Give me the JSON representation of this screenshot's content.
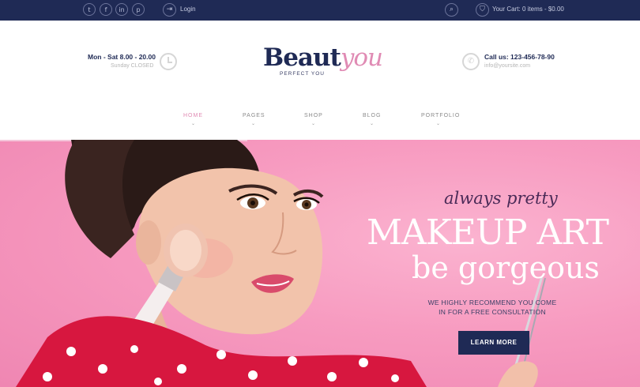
{
  "topbar": {
    "social": [
      {
        "icon": "twitter-icon",
        "glyph": "t"
      },
      {
        "icon": "facebook-icon",
        "glyph": "f"
      },
      {
        "icon": "linkedin-icon",
        "glyph": "in"
      },
      {
        "icon": "pinterest-icon",
        "glyph": "p"
      }
    ],
    "login_label": "Login",
    "cart_label": "Your Cart: 0 items - $0.00"
  },
  "header": {
    "hours_title": "Mon - Sat 8.00 - 20.00",
    "hours_sub": "Sunday CLOSED",
    "logo_part1": "Beaut",
    "logo_part2": "you",
    "tagline": "PERFECT YOU",
    "call_title": "Call us: 123-456-78-90",
    "call_sub": "info@yoursite.com"
  },
  "nav": {
    "items": [
      {
        "label": "HOME",
        "active": true
      },
      {
        "label": "PAGES",
        "active": false
      },
      {
        "label": "SHOP",
        "active": false
      },
      {
        "label": "BLOG",
        "active": false
      },
      {
        "label": "PORTFOLIO",
        "active": false
      }
    ],
    "caret": "⌄"
  },
  "hero": {
    "script": "always pretty",
    "headline": "MAKEUP ART",
    "subhead": "be gorgeous",
    "note_line1": "WE HIGHLY RECOMMEND YOU COME",
    "note_line2": "IN FOR A FREE CONSULTATION",
    "cta_label": "LEARN MORE"
  },
  "colors": {
    "navy": "#1f2a55",
    "pink_accent": "#e08bb4",
    "hero_pink": "#f79bc0"
  }
}
